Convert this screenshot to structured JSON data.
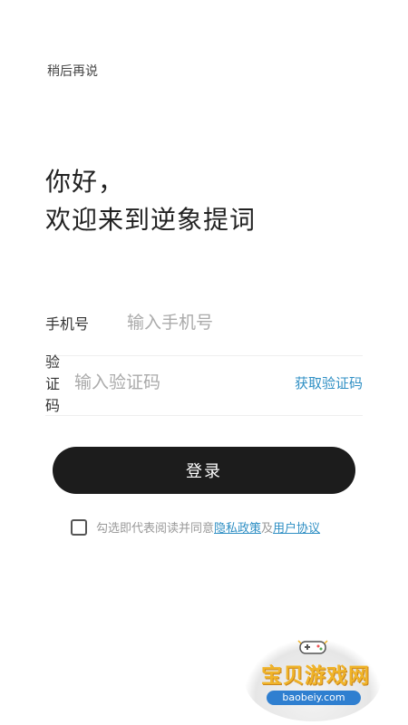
{
  "header": {
    "skip_label": "稍后再说"
  },
  "greeting": {
    "line1": "你好，",
    "line2": "欢迎来到逆象提词"
  },
  "form": {
    "phone": {
      "label": "手机号",
      "placeholder": "输入手机号",
      "value": ""
    },
    "code": {
      "label": "验证码",
      "placeholder": "输入验证码",
      "value": "",
      "get_code_label": "获取验证码"
    }
  },
  "login_label": "登录",
  "agreement": {
    "prefix": "勾选即代表阅读并同意",
    "privacy_link": "隐私政策",
    "and": "及",
    "terms_link": "用户协议",
    "checked": false
  },
  "watermark": {
    "title": "宝贝游戏网",
    "url": "baobeiy.com"
  },
  "colors": {
    "accent": "#2f8fc4",
    "button": "#1c1c1c",
    "background": "#ffffff"
  }
}
